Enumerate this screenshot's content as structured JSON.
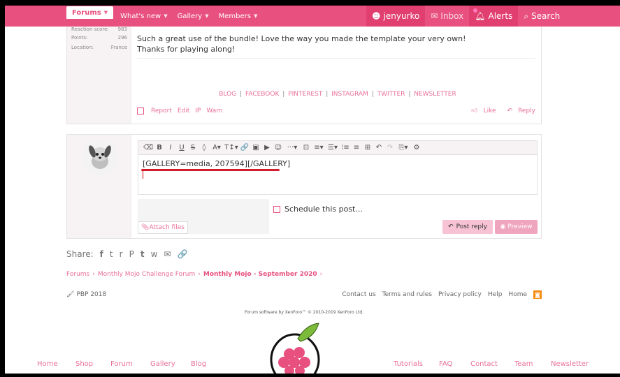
{
  "nav": {
    "forums": "Forums",
    "whats_new": "What's new",
    "gallery": "Gallery",
    "members": "Members",
    "user": "jenyurko",
    "inbox": "Inbox",
    "alerts": "Alerts",
    "search": "Search"
  },
  "post": {
    "stats": [
      {
        "label": "Reaction score:",
        "value": "983"
      },
      {
        "label": "Points:",
        "value": "296"
      },
      {
        "label": "Location:",
        "value": "France"
      }
    ],
    "line1": "Such a great use of the bundle! Love the way you made the template your very own!",
    "line2": "Thanks for playing along!",
    "links": [
      "BLOG",
      "FACEBOOK",
      "PINTEREST",
      "INSTAGRAM",
      "TWITTER",
      "NEWSLETTER"
    ],
    "sep": "|",
    "actions": [
      "Report",
      "Edit",
      "IP",
      "Warn"
    ],
    "like": "Like",
    "reply": "Reply"
  },
  "editor": {
    "content": "[GALLERY=media, 207594][/GALLERY]",
    "toolbar": [
      "⌫",
      "B",
      "I",
      "U",
      "S",
      "◊",
      "A▾",
      "T↕▾",
      "🔗",
      "▣",
      "▶",
      "☺",
      "···▾",
      "⊡",
      "≡▾",
      "☰▾",
      "⁝≡",
      "≡",
      "⊞",
      "↶",
      "↷",
      "⎘▾",
      "⚙"
    ]
  },
  "reply_form": {
    "attach": "Attach files",
    "schedule": "Schedule this post...",
    "post_reply": "Post reply",
    "preview": "Preview"
  },
  "share": {
    "label": "Share:",
    "icons": [
      "f",
      "t",
      "r",
      "P",
      "t",
      "w",
      "✉",
      "🔗"
    ]
  },
  "breadcrumb": [
    "Forums",
    "Monthly Mojo Challenge Forum",
    "Monthly Mojo - September 2020"
  ],
  "footer": {
    "style": "PBP 2018",
    "links": [
      "Contact us",
      "Terms and rules",
      "Privacy policy",
      "Help",
      "Home"
    ],
    "rss": "◙",
    "copyright": "Forum software by XenForo™ © 2010-2019 XenForo Ltd."
  },
  "bottom_nav": [
    "Home",
    "Shop",
    "Forum",
    "Gallery",
    "Blog",
    "Tutorials",
    "FAQ",
    "Contact",
    "Team",
    "Newsletter"
  ],
  "colors": {
    "brand": "#e8507f",
    "link": "#e8709a"
  }
}
